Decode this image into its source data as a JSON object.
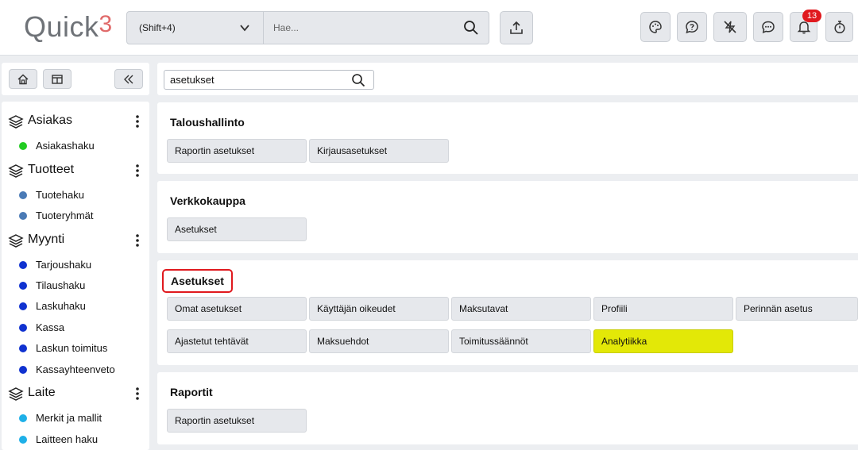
{
  "header": {
    "logo_text": "Quick",
    "logo_num": "3",
    "scope_label": "(Shift+4)",
    "search_placeholder": "Hae...",
    "notification_count": "13",
    "icons": [
      "upload-icon",
      "palette-icon",
      "help-icon",
      "flash-off-icon",
      "chat-icon",
      "bell-icon",
      "timer-icon"
    ]
  },
  "sidebar": {
    "sections": [
      {
        "title": "Asiakas",
        "items": [
          {
            "label": "Asiakashaku",
            "color": "#22cc22"
          }
        ]
      },
      {
        "title": "Tuotteet",
        "items": [
          {
            "label": "Tuotehaku",
            "color": "#4a7ab5"
          },
          {
            "label": "Tuoteryhmät",
            "color": "#4a7ab5"
          }
        ]
      },
      {
        "title": "Myynti",
        "items": [
          {
            "label": "Tarjoushaku",
            "color": "#1032d0"
          },
          {
            "label": "Tilaushaku",
            "color": "#1032d0"
          },
          {
            "label": "Laskuhaku",
            "color": "#1032d0"
          },
          {
            "label": "Kassa",
            "color": "#1032d0"
          },
          {
            "label": "Laskun toimitus",
            "color": "#1032d0"
          },
          {
            "label": "Kassayhteenveto",
            "color": "#1032d0"
          }
        ]
      },
      {
        "title": "Laite",
        "items": [
          {
            "label": "Merkit ja mallit",
            "color": "#1eb0e8"
          },
          {
            "label": "Laitteen haku",
            "color": "#1eb0e8"
          }
        ]
      }
    ]
  },
  "filter": {
    "value": "asetukset"
  },
  "groups": [
    {
      "title": "Taloushallinto",
      "tiles": [
        "Raportin asetukset",
        "Kirjausasetukset"
      ]
    },
    {
      "title": "Verkkokauppa",
      "tiles": [
        "Asetukset"
      ]
    },
    {
      "title": "Asetukset",
      "tiles": [
        "Omat asetukset",
        "Käyttäjän oikeudet",
        "Maksutavat",
        "Profiili",
        "Perinnän asetus",
        "Ajastetut tehtävät",
        "Maksuehdot",
        "Toimitussäännöt",
        "Analytiikka"
      ],
      "highlighted_tile": "Analytiikka",
      "highlight_color": "#e3e807"
    },
    {
      "title": "Raportit",
      "tiles": [
        "Raportin asetukset"
      ]
    }
  ],
  "colors": {
    "accent_red": "#e0191e",
    "tile_bg": "#e6e8ec"
  }
}
